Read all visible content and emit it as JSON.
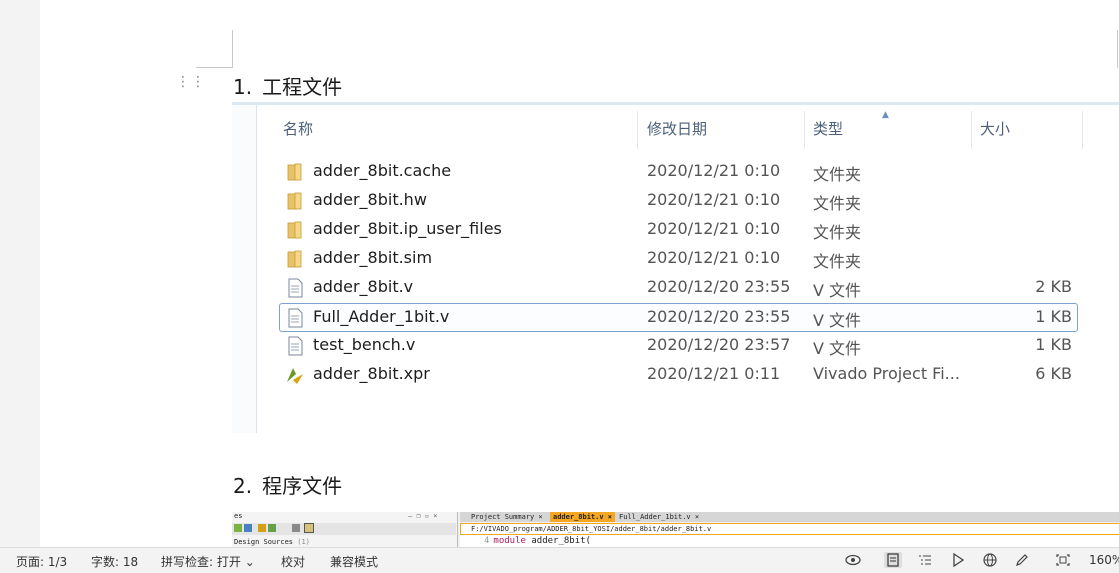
{
  "headings": [
    {
      "num": "1.",
      "text": "工程文件"
    },
    {
      "num": "2.",
      "text": "程序文件"
    }
  ],
  "explorer": {
    "columns": [
      "名称",
      "修改日期",
      "类型",
      "大小"
    ],
    "rows": [
      {
        "icon": "folder-icon",
        "name": "adder_8bit.cache",
        "date": "2020/12/21 0:10",
        "type": "文件夹",
        "size": ""
      },
      {
        "icon": "folder-icon",
        "name": "adder_8bit.hw",
        "date": "2020/12/21 0:10",
        "type": "文件夹",
        "size": ""
      },
      {
        "icon": "folder-icon",
        "name": "adder_8bit.ip_user_files",
        "date": "2020/12/21 0:10",
        "type": "文件夹",
        "size": ""
      },
      {
        "icon": "folder-icon",
        "name": "adder_8bit.sim",
        "date": "2020/12/21 0:10",
        "type": "文件夹",
        "size": ""
      },
      {
        "icon": "file-icon",
        "name": "adder_8bit.v",
        "date": "2020/12/20 23:55",
        "type": "V 文件",
        "size": "2 KB"
      },
      {
        "icon": "file-icon",
        "name": "Full_Adder_1bit.v",
        "date": "2020/12/20 23:55",
        "type": "V 文件",
        "size": "1 KB",
        "selected": true
      },
      {
        "icon": "file-icon",
        "name": "test_bench.v",
        "date": "2020/12/20 23:57",
        "type": "V 文件",
        "size": "1 KB"
      },
      {
        "icon": "vivado-project-icon",
        "name": "adder_8bit.xpr",
        "date": "2020/12/21 0:11",
        "type": "Vivado Project Fi...",
        "size": "6 KB"
      }
    ]
  },
  "vivado": {
    "left_title": "es",
    "design_sources": "Design Sources",
    "design_sources_count": "(1)",
    "tabs": [
      "Project Summary",
      "adder_8bit.v",
      "Full_Adder_1bit.v"
    ],
    "path": "F:/VIVADO_program/ADDER_8bit_YOSI/adder_8bit/adder_8bit.v",
    "line_no": "4",
    "code_kw": "module",
    "code_rest": " adder_8bit("
  },
  "statusbar": {
    "page": "页面: 1/3",
    "words": "字数: 18",
    "spell": "拼写检查: 打开",
    "proof": "校对",
    "compat": "兼容模式",
    "zoom": "160%"
  },
  "colors": {
    "explorer_text": "#1e395b",
    "header_text": "#4c607a",
    "selection_border": "#7da2ce",
    "vivado_accent": "#f5a623"
  }
}
